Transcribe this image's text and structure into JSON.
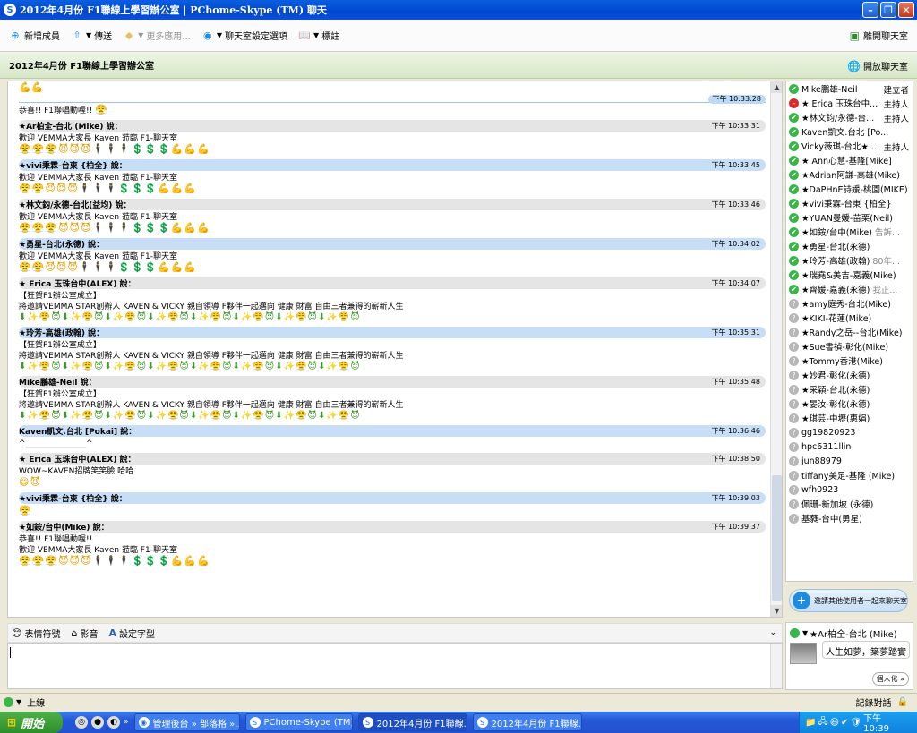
{
  "window": {
    "title": "2012年4月份 F1聯線上學習辦公室 | PChome-Skype (TM) 聊天"
  },
  "toolbar": {
    "add_member": "新增成員",
    "send": "傳送",
    "more_apps": "更多應用...",
    "room_settings": "聊天室設定選項",
    "bookmark": "標註",
    "leave_room": "離開聊天室"
  },
  "room": {
    "title": "2012年4月份 F1聯線上學習辦公室",
    "open_room": "開放聊天室"
  },
  "chat": {
    "top_time": "下午 10:33:28",
    "pre_text": "恭喜!! F1聯唱動喔!!",
    "messages": [
      {
        "sender": "★Ar柏全-台北 (Mike) 說：",
        "time": "下午 10:33:31",
        "style": "gray",
        "lines": [
          "歡迎 VEMMA大家長 Kaven 蒞臨 F1-聊天室"
        ],
        "emo": "😤😤😤😈😈😈🕴🕴🕴💲💲💲💪💪💪"
      },
      {
        "sender": "★vivi秉霖-台東 {柏全} 說：",
        "time": "下午 10:33:45",
        "style": "blue",
        "lines": [
          "歡迎 VEMMA大家長 Kaven 蒞臨 F1-聊天室"
        ],
        "emo": "😤😤😈😈😈🕴🕴🕴💲💲💲💪💪💪"
      },
      {
        "sender": "★林文鈞/永德-台北(益均) 說：",
        "time": "下午 10:33:46",
        "style": "gray",
        "lines": [
          "歡迎 VEMMA大家長 Kaven 蒞臨 F1-聊天室"
        ],
        "emo": "😤😤😤😈😈😈🕴🕴🕴💲💲💲💪💪💪"
      },
      {
        "sender": "★勇星-台北(永德) 說：",
        "time": "下午 10:34:02",
        "style": "blue",
        "lines": [
          "歡迎 VEMMA大家長 Kaven 蒞臨 F1-聊天室"
        ],
        "emo": "😤😤😈😈😈🕴🕴🕴💲💲💲💪💪💪"
      },
      {
        "sender": "★ Erica 玉珠台中(ALEX) 說：",
        "time": "下午 10:34:07",
        "style": "gray",
        "lines": [
          "【狂賀F1辦公室成立】",
          "將邀請VEMMA STAR創辦人 KAVEN & VICKY 親自領導 F夥伴一起邁向 健康 財富 自由三者兼得的嶄新人生"
        ],
        "arrows": "⬇✨😤😈⬇✨😤😈⬇✨😤😈⬇✨😤😈⬇✨😤😈⬇✨😤😈⬇✨😤😈⬇✨😤😈"
      },
      {
        "sender": "★玲芳-高雄(政翰) 說：",
        "time": "下午 10:35:31",
        "style": "blue",
        "lines": [
          "【狂賀F1辦公室成立】",
          "將邀請VEMMA STAR創辦人 KAVEN & VICKY 親自領導 F夥伴一起邁向 健康 財富 自由三者兼得的嶄新人生"
        ],
        "arrows": "⬇✨😤😈⬇✨😤😈⬇✨😤😈⬇✨😤😈⬇✨😤😈⬇✨😤😈⬇✨😤😈⬇✨😤😈"
      },
      {
        "sender": "Mike鵬雄-Neil 說：",
        "time": "下午 10:35:48",
        "style": "gray",
        "lines": [
          "【狂賀F1辦公室成立】",
          "將邀請VEMMA STAR創辦人 KAVEN & VICKY 親自領導 F夥伴一起邁向 健康 財富 自由三者兼得的嶄新人生"
        ],
        "arrows": "⬇✨😤😈⬇✨😤😈⬇✨😤😈⬇✨😤😈⬇✨😤😈⬇✨😤😈⬇✨😤😈⬇✨😤😈"
      },
      {
        "sender": "Kaven凱文.台北 [Pokai] 說：",
        "time": "下午 10:36:46",
        "style": "blue",
        "lines": [
          "^_______________^"
        ]
      },
      {
        "sender": "★ Erica 玉珠台中(ALEX) 說：",
        "time": "下午 10:38:50",
        "style": "gray",
        "lines": [
          "WOW~KAVEN招牌笑笑臉 哈哈"
        ],
        "emo": "😄😈"
      },
      {
        "sender": "★vivi秉霖-台東 {柏全} 說：",
        "time": "下午 10:39:03",
        "style": "blue",
        "lines": [],
        "emo": "😤"
      },
      {
        "sender": "★如銨/台中(Mike) 說：",
        "time": "下午 10:39:37",
        "style": "gray",
        "lines": [
          "恭喜!! F1聯唱動喔!!",
          "歡迎 VEMMA大家長 Kaven 蒞臨 F1-聊天室"
        ],
        "emo": "😤😤😤😈😈😈🕴🕴🕴💲💲💲💪💪💪"
      }
    ]
  },
  "input_toolbar": {
    "emoticons": "表情符號",
    "video": "影音",
    "font": "設定字型"
  },
  "participants": [
    {
      "name": "Mike鵬雄-Neil",
      "role": "建立者",
      "status": "online"
    },
    {
      "name": "★ Erica 玉珠台中...",
      "role": "主持人",
      "status": "busy"
    },
    {
      "name": "★林文鈞/永德-台...",
      "role": "主持人",
      "status": "online"
    },
    {
      "name": "Kaven凱文.台北 [Po...",
      "role": "",
      "status": "online"
    },
    {
      "name": "Vicky薇琪-台北★...",
      "role": "主持人",
      "status": "online"
    },
    {
      "name": "★ Ann心慧-基隆[Mike]",
      "role": "",
      "status": "online"
    },
    {
      "name": "★Adrian阿謙-高雄(Mike)",
      "role": "",
      "status": "online"
    },
    {
      "name": "★DaPHnE詩媛-桃園(MIKE)",
      "role": "",
      "status": "online"
    },
    {
      "name": "★vivi秉霖-台東 {柏全}",
      "role": "",
      "status": "online"
    },
    {
      "name": "★YUAN曼媛-苗栗(Neil)",
      "role": "",
      "status": "online"
    },
    {
      "name": "★如銨/台中(Mike)",
      "role": "",
      "mood": "告訴...",
      "status": "online"
    },
    {
      "name": "★勇星-台北(永德)",
      "role": "",
      "status": "online"
    },
    {
      "name": "★玲芳-高雄(政翰)",
      "role": "",
      "mood": "80年...",
      "status": "online"
    },
    {
      "name": "★瑞堯&美吉-嘉義(Mike)",
      "role": "",
      "status": "online"
    },
    {
      "name": "★齊媛-嘉義(永德)",
      "role": "",
      "mood": "我正...",
      "status": "online"
    },
    {
      "name": "★amy庭秀-台北(Mike)",
      "role": "",
      "status": "offline"
    },
    {
      "name": "★KIKI-花蓮(Mike)",
      "role": "",
      "status": "offline"
    },
    {
      "name": "★Randy之岳--台北(Mike)",
      "role": "",
      "status": "offline"
    },
    {
      "name": "★Sue書禎-彰化(Mike)",
      "role": "",
      "status": "offline"
    },
    {
      "name": "★Tommy香港(Mike)",
      "role": "",
      "status": "offline"
    },
    {
      "name": "★妙君-彰化(永德)",
      "role": "",
      "status": "offline"
    },
    {
      "name": "★采穎-台北(永德)",
      "role": "",
      "status": "offline"
    },
    {
      "name": "★晏汝-彰化(永德)",
      "role": "",
      "status": "offline"
    },
    {
      "name": "★琪芸-中壢(惠娟)",
      "role": "",
      "status": "offline"
    },
    {
      "name": "gg19820923",
      "role": "",
      "status": "offline"
    },
    {
      "name": "hpc6311llin",
      "role": "",
      "status": "offline"
    },
    {
      "name": "jun88979",
      "role": "",
      "status": "offline"
    },
    {
      "name": "tiffany美足-基隆 (Mike)",
      "role": "",
      "status": "offline"
    },
    {
      "name": "wfh0923",
      "role": "",
      "status": "offline"
    },
    {
      "name": "佩珊-新加坡 (永德)",
      "role": "",
      "status": "offline"
    },
    {
      "name": "基蕤-台中(勇星)",
      "role": "",
      "status": "offline"
    }
  ],
  "invite": {
    "label": "邀請其他使用者一起來聊天室"
  },
  "profile": {
    "name": "★Ar柏全-台北 (Mike)",
    "mood": "人生如夢，築夢踏實",
    "personal": "個人化 »"
  },
  "statusbar": {
    "status": "上線",
    "history": "記錄對話"
  },
  "taskbar": {
    "start": "開始",
    "tasks": [
      {
        "label": "管理後台 » 部落格 »...",
        "active": false
      },
      {
        "label": "PChome-Skype (TM) ...",
        "active": false
      },
      {
        "label": "2012年4月份 F1聯線...",
        "active": true
      },
      {
        "label": "2012年4月份 F1聯線...",
        "active": false
      }
    ],
    "clock": "下午 10:39"
  }
}
